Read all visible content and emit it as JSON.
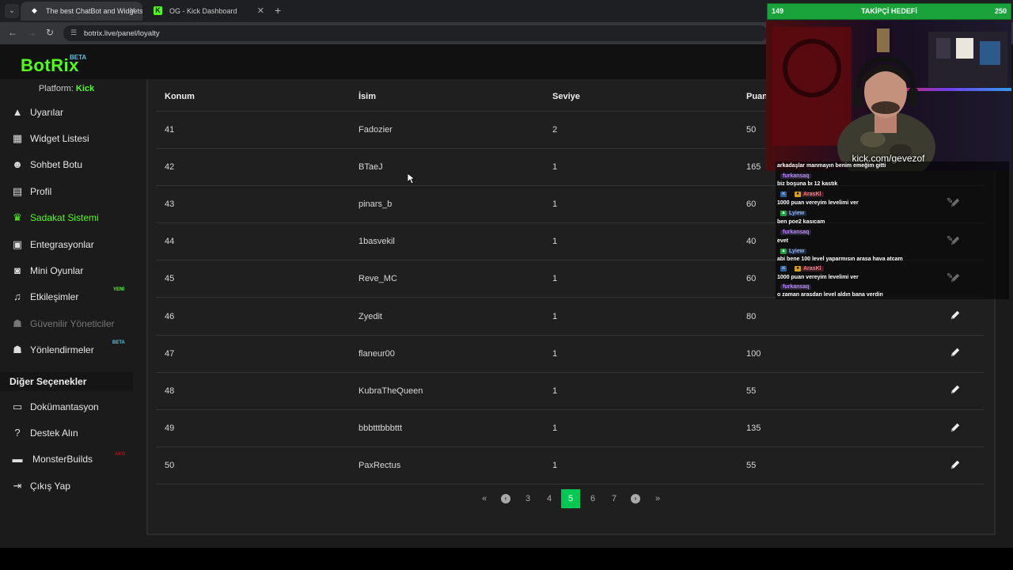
{
  "browser": {
    "tabs": [
      {
        "title": "The best ChatBot and Widgets",
        "active": true
      },
      {
        "title": "OG - Kick Dashboard",
        "active": false
      }
    ],
    "url": "botrix.live/panel/loyalty"
  },
  "brand": {
    "logo": "BotRix",
    "badge": "BETA",
    "accent": "#53fc18"
  },
  "platform": {
    "label": "Platform:",
    "value": "Kick"
  },
  "sidebar": {
    "items": [
      {
        "label": "Uyarılar",
        "icon": "warning-icon"
      },
      {
        "label": "Widget Listesi",
        "icon": "widgets-icon"
      },
      {
        "label": "Sohbet Botu",
        "icon": "robot-icon"
      },
      {
        "label": "Profil",
        "icon": "profile-card-icon"
      },
      {
        "label": "Sadakat Sistemi",
        "icon": "trophy-icon",
        "active": true
      },
      {
        "label": "Entegrasyonlar",
        "icon": "integration-icon"
      },
      {
        "label": "Mini Oyunlar",
        "icon": "gamepad-icon"
      },
      {
        "label": "Etkileşimler",
        "icon": "music-icon",
        "badge": "YENİ"
      },
      {
        "label": "Güvenilir Yöneticiler",
        "icon": "users-icon",
        "disabled": true
      },
      {
        "label": "Yönlendirmeler",
        "icon": "users-icon",
        "badge": "BETA"
      }
    ],
    "section": "Diğer Seçenekler",
    "other": [
      {
        "label": "Dokümantasyon",
        "icon": "scroll-icon"
      },
      {
        "label": "Destek Alın",
        "icon": "help-icon"
      },
      {
        "label": "MonsterBuilds",
        "icon": "laptop-icon",
        "badge": "AKO"
      },
      {
        "label": "Çıkış Yap",
        "icon": "logout-icon"
      }
    ]
  },
  "table": {
    "columns": [
      "Konum",
      "İsim",
      "Seviye",
      "Puan"
    ],
    "rows": [
      [
        "41",
        "Fadozier",
        "2",
        "50"
      ],
      [
        "42",
        "BTaeJ",
        "1",
        "165"
      ],
      [
        "43",
        "pinars_b",
        "1",
        "60"
      ],
      [
        "44",
        "1basvekil",
        "1",
        "40"
      ],
      [
        "45",
        "Reve_MC",
        "1",
        "60"
      ],
      [
        "46",
        "Zyedit",
        "1",
        "80"
      ],
      [
        "47",
        "flaneur00",
        "1",
        "100"
      ],
      [
        "48",
        "KubraTheQueen",
        "1",
        "55"
      ],
      [
        "49",
        "bbbtttbbbttt",
        "1",
        "135"
      ],
      [
        "50",
        "PaxRectus",
        "1",
        "55"
      ]
    ]
  },
  "pagination": {
    "pages": [
      "3",
      "4",
      "5",
      "6",
      "7"
    ],
    "current": "5"
  },
  "overlay": {
    "goal_current": "149",
    "goal_label": "TAKİPÇİ HEDEFİ",
    "goal_target": "250",
    "stream_url": "kick.com/gevezof",
    "chat": [
      {
        "user": "",
        "msg": "arkadaşlar manmayın benim emeğim gitti"
      },
      {
        "user": "furkansaq",
        "msg": "biz boşuna bı 12 kastık",
        "color": "#b784ff"
      },
      {
        "user": "ArasKl",
        "msg": "1000 puan vereyim levelimi ver",
        "color": "#ff7a7a"
      },
      {
        "user": "Lyiew",
        "msg": "ben poe2 kasıcam",
        "color": "#8ab4ff"
      },
      {
        "user": "furkansaq",
        "msg": "evet",
        "color": "#b784ff"
      },
      {
        "user": "Lyiew",
        "msg": "abi bene 100 level yaparmısın arasa hava atcam",
        "color": "#8ab4ff"
      },
      {
        "user": "ArasKl",
        "msg": "1000 puan vereyim levelimi ver",
        "color": "#ff7a7a"
      },
      {
        "user": "furkansaq",
        "msg": "o zaman arasdan level aldın bana verdin",
        "color": "#b784ff"
      }
    ]
  }
}
